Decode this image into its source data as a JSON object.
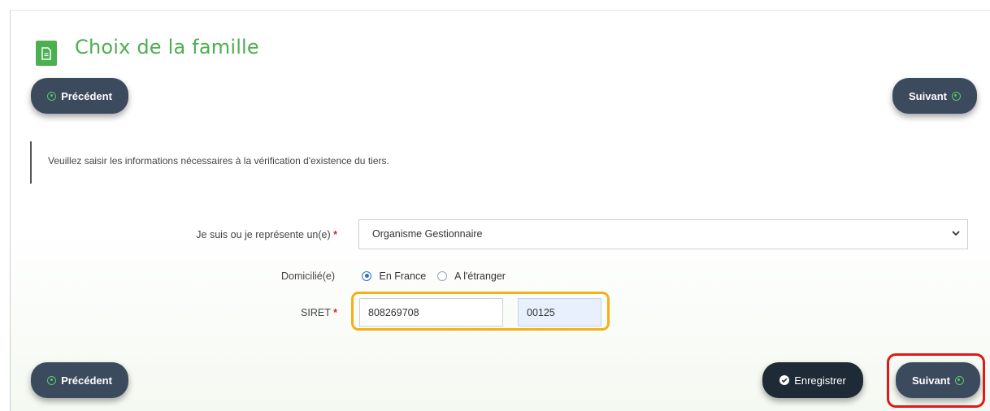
{
  "page": {
    "title": "Choix de la famille"
  },
  "nav": {
    "prev_label": "Précédent",
    "next_label": "Suivant",
    "save_label": "Enregistrer"
  },
  "info": {
    "text": "Veuillez saisir les informations nécessaires à la vérification d'existence du tiers."
  },
  "form": {
    "type_label": "Je suis ou je représente un(e)",
    "type_value": "Organisme Gestionnaire",
    "required_mark": "*",
    "domicile_label": "Domicilié(e)",
    "domicile_options": [
      "En France",
      "A l'étranger"
    ],
    "domicile_selected": "En France",
    "siret_label": "SIRET",
    "siret_part1": "808269708",
    "siret_part2": "00125"
  },
  "colors": {
    "accent_green": "#4caf50",
    "button_dark": "#3b4a5c",
    "highlight_orange": "#f4b014",
    "highlight_red": "#e21818"
  }
}
